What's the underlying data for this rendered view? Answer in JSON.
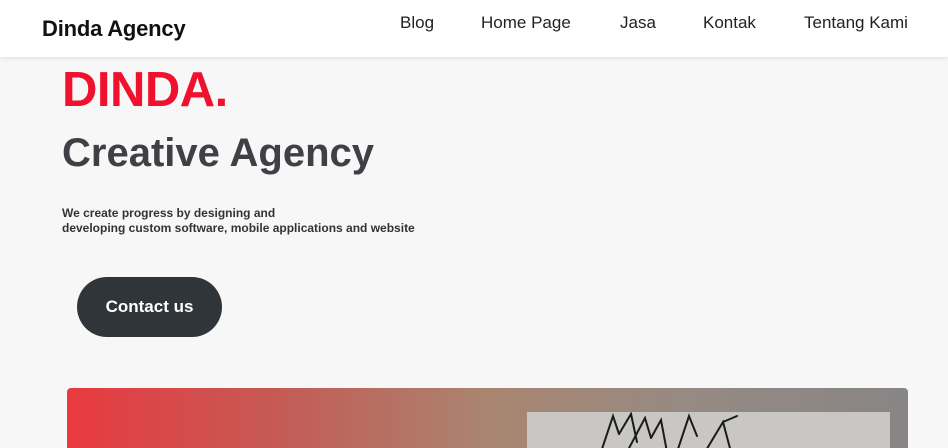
{
  "nav": {
    "brand": "Dinda Agency",
    "links": [
      "Blog",
      "Home Page",
      "Jasa",
      "Kontak",
      "Tentang Kami"
    ]
  },
  "hero": {
    "title": "DINDA.",
    "subtitle": "Creative Agency",
    "description_line1": "We create progress by designing and",
    "description_line2": "developing custom software, mobile applications and website",
    "cta_label": "Contact us"
  },
  "colors": {
    "accent_red": "#f0112f",
    "button_dark": "#30353a",
    "text_dark": "#3f4045",
    "page_background": "#f7f7f7"
  },
  "banner": {
    "image_icon": "abstract-line-art-image"
  }
}
